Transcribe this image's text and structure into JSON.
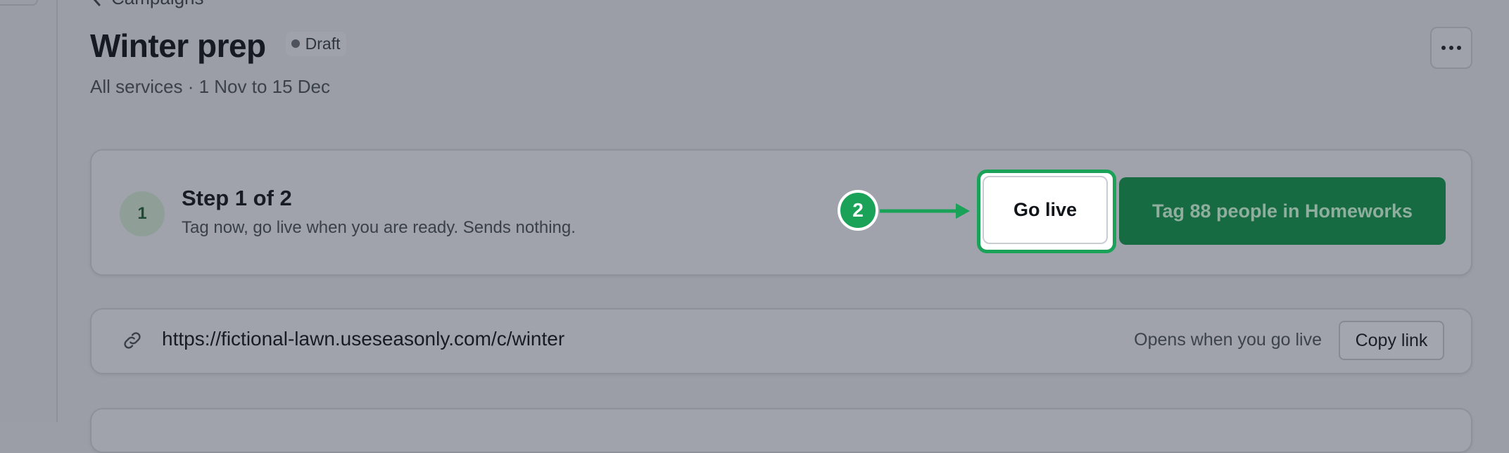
{
  "breadcrumb": {
    "back_label": "Campaigns"
  },
  "campaign": {
    "title": "Winter prep",
    "status": "Draft",
    "subtitle": "All services · 1 Nov to 15 Dec"
  },
  "step": {
    "number": "1",
    "title": "Step 1 of 2",
    "description": "Tag now, go live when you are ready. Sends nothing."
  },
  "callout": {
    "number": "2"
  },
  "actions": {
    "go_live_label": "Go live",
    "tag_label": "Tag 88 people in Homeworks"
  },
  "share": {
    "url": "https://fictional-lawn.useseasonly.com/c/winter",
    "note": "Opens when you go live",
    "copy_label": "Copy link"
  },
  "icons": {
    "back": "chevron-left-icon",
    "more": "more-horizontal-icon",
    "link": "link-icon",
    "callout_arrow": "arrow-right-icon"
  },
  "colors": {
    "accent_green": "#1aa259",
    "primary_button": "#166b42",
    "overlay_bg": "#9b9ea6"
  }
}
